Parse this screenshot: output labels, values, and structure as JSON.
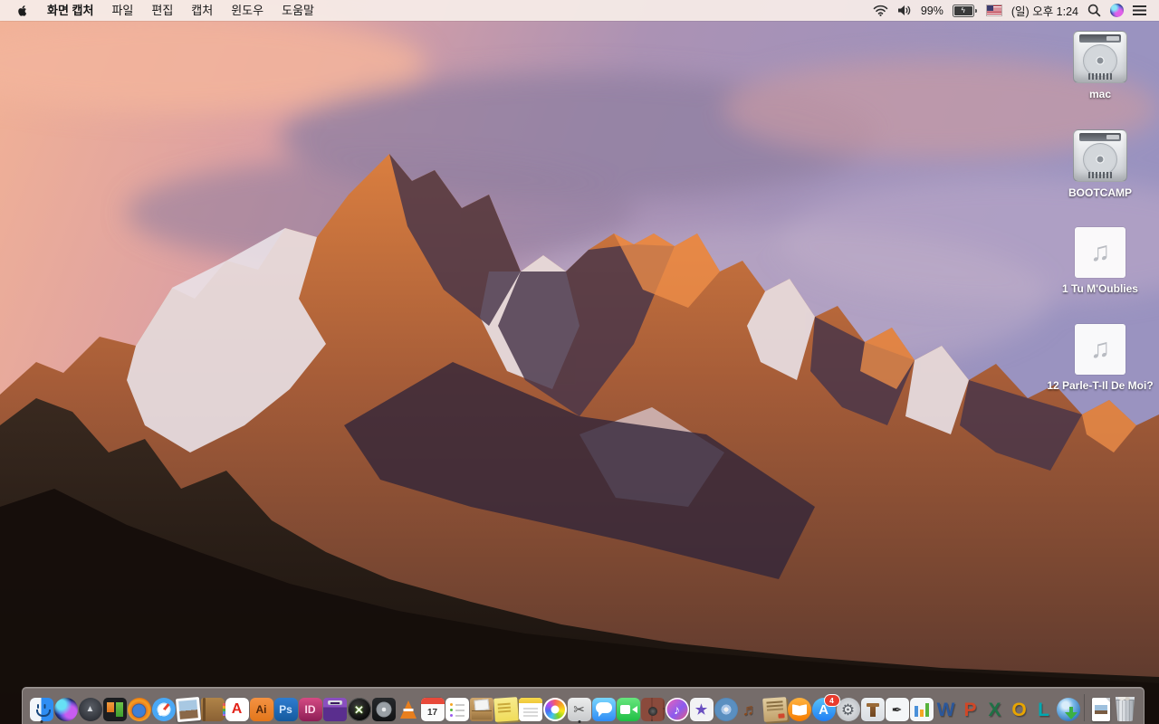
{
  "menu_bar": {
    "apple_icon": "apple-logo",
    "items": [
      {
        "id": "screen-capture",
        "label": "화면 캡처",
        "bold": true
      },
      {
        "id": "file",
        "label": "파일"
      },
      {
        "id": "edit",
        "label": "편집"
      },
      {
        "id": "capture",
        "label": "캡처"
      },
      {
        "id": "window",
        "label": "윈도우"
      },
      {
        "id": "help",
        "label": "도움말"
      }
    ],
    "status": {
      "battery_percent": "99%",
      "battery_charging": true,
      "clock": "(일) 오후 1:24",
      "icons": [
        "wifi-icon",
        "volume-icon",
        "battery-icon",
        "input-source-us-flag",
        "spotlight-icon",
        "siri-icon",
        "notification-center-icon"
      ]
    }
  },
  "desktop": {
    "audio_glyph": "♫",
    "icons": [
      {
        "id": "mac",
        "kind": "drive",
        "label": "mac"
      },
      {
        "id": "bootcamp",
        "kind": "drive",
        "label": "BOOTCAMP"
      },
      {
        "id": "tu-moublies",
        "kind": "audio",
        "label": "1 Tu M'Oublies"
      },
      {
        "id": "parle-t-il-de-moi",
        "kind": "audio",
        "label": "12 Parle-T-Il De Moi?"
      }
    ]
  },
  "dock": {
    "items": [
      {
        "id": "finder",
        "running": true
      },
      {
        "id": "siri"
      },
      {
        "id": "launchpad",
        "glyph": "▲"
      },
      {
        "id": "window-tiles"
      },
      {
        "id": "firefox"
      },
      {
        "id": "safari"
      },
      {
        "id": "preview"
      },
      {
        "id": "contacts"
      },
      {
        "id": "acrobat-reader",
        "glyph": "A"
      },
      {
        "id": "illustrator",
        "glyph": "Ai"
      },
      {
        "id": "photoshop",
        "glyph": "Ps"
      },
      {
        "id": "indesign",
        "glyph": "ID"
      },
      {
        "id": "toast"
      },
      {
        "id": "x-app",
        "glyph": "✕"
      },
      {
        "id": "disk-speed"
      },
      {
        "id": "vlc"
      },
      {
        "id": "calendar",
        "glyph": "17"
      },
      {
        "id": "reminders"
      },
      {
        "id": "unarchiver"
      },
      {
        "id": "stickies"
      },
      {
        "id": "notes"
      },
      {
        "id": "photos"
      },
      {
        "id": "grab",
        "glyph": "✂",
        "running": true
      },
      {
        "id": "messages"
      },
      {
        "id": "facetime"
      },
      {
        "id": "photo-booth"
      },
      {
        "id": "itunes",
        "glyph": "♪"
      },
      {
        "id": "imovie",
        "glyph": "★"
      },
      {
        "id": "dvd-player"
      },
      {
        "id": "garageband",
        "glyph": "♬"
      },
      {
        "id": "papers-stack"
      },
      {
        "id": "ibooks"
      },
      {
        "id": "app-store",
        "glyph": "A",
        "badge": "4"
      },
      {
        "id": "system-preferences",
        "glyph": "⚙"
      },
      {
        "id": "keynote"
      },
      {
        "id": "pages",
        "glyph": "✒"
      },
      {
        "id": "numbers"
      },
      {
        "id": "word",
        "glyph": "W"
      },
      {
        "id": "powerpoint",
        "glyph": "P"
      },
      {
        "id": "excel",
        "glyph": "X"
      },
      {
        "id": "outlook",
        "glyph": "O"
      },
      {
        "id": "lync",
        "glyph": "L"
      },
      {
        "id": "downloader"
      },
      {
        "type": "separator"
      },
      {
        "id": "minimized-document"
      },
      {
        "id": "trash"
      }
    ]
  },
  "colors": {
    "menu_bar_bg": "#f6ebe7",
    "dock_bg": "rgba(197,187,186,0.55)",
    "badge_red": "#e83b2e",
    "desktop_label": "#ffffff",
    "sky_pink": "#efae93",
    "sky_lavender": "#9a93c0",
    "mountain_orange": "#d97a3c",
    "foreground_rock": "#1a110e"
  }
}
